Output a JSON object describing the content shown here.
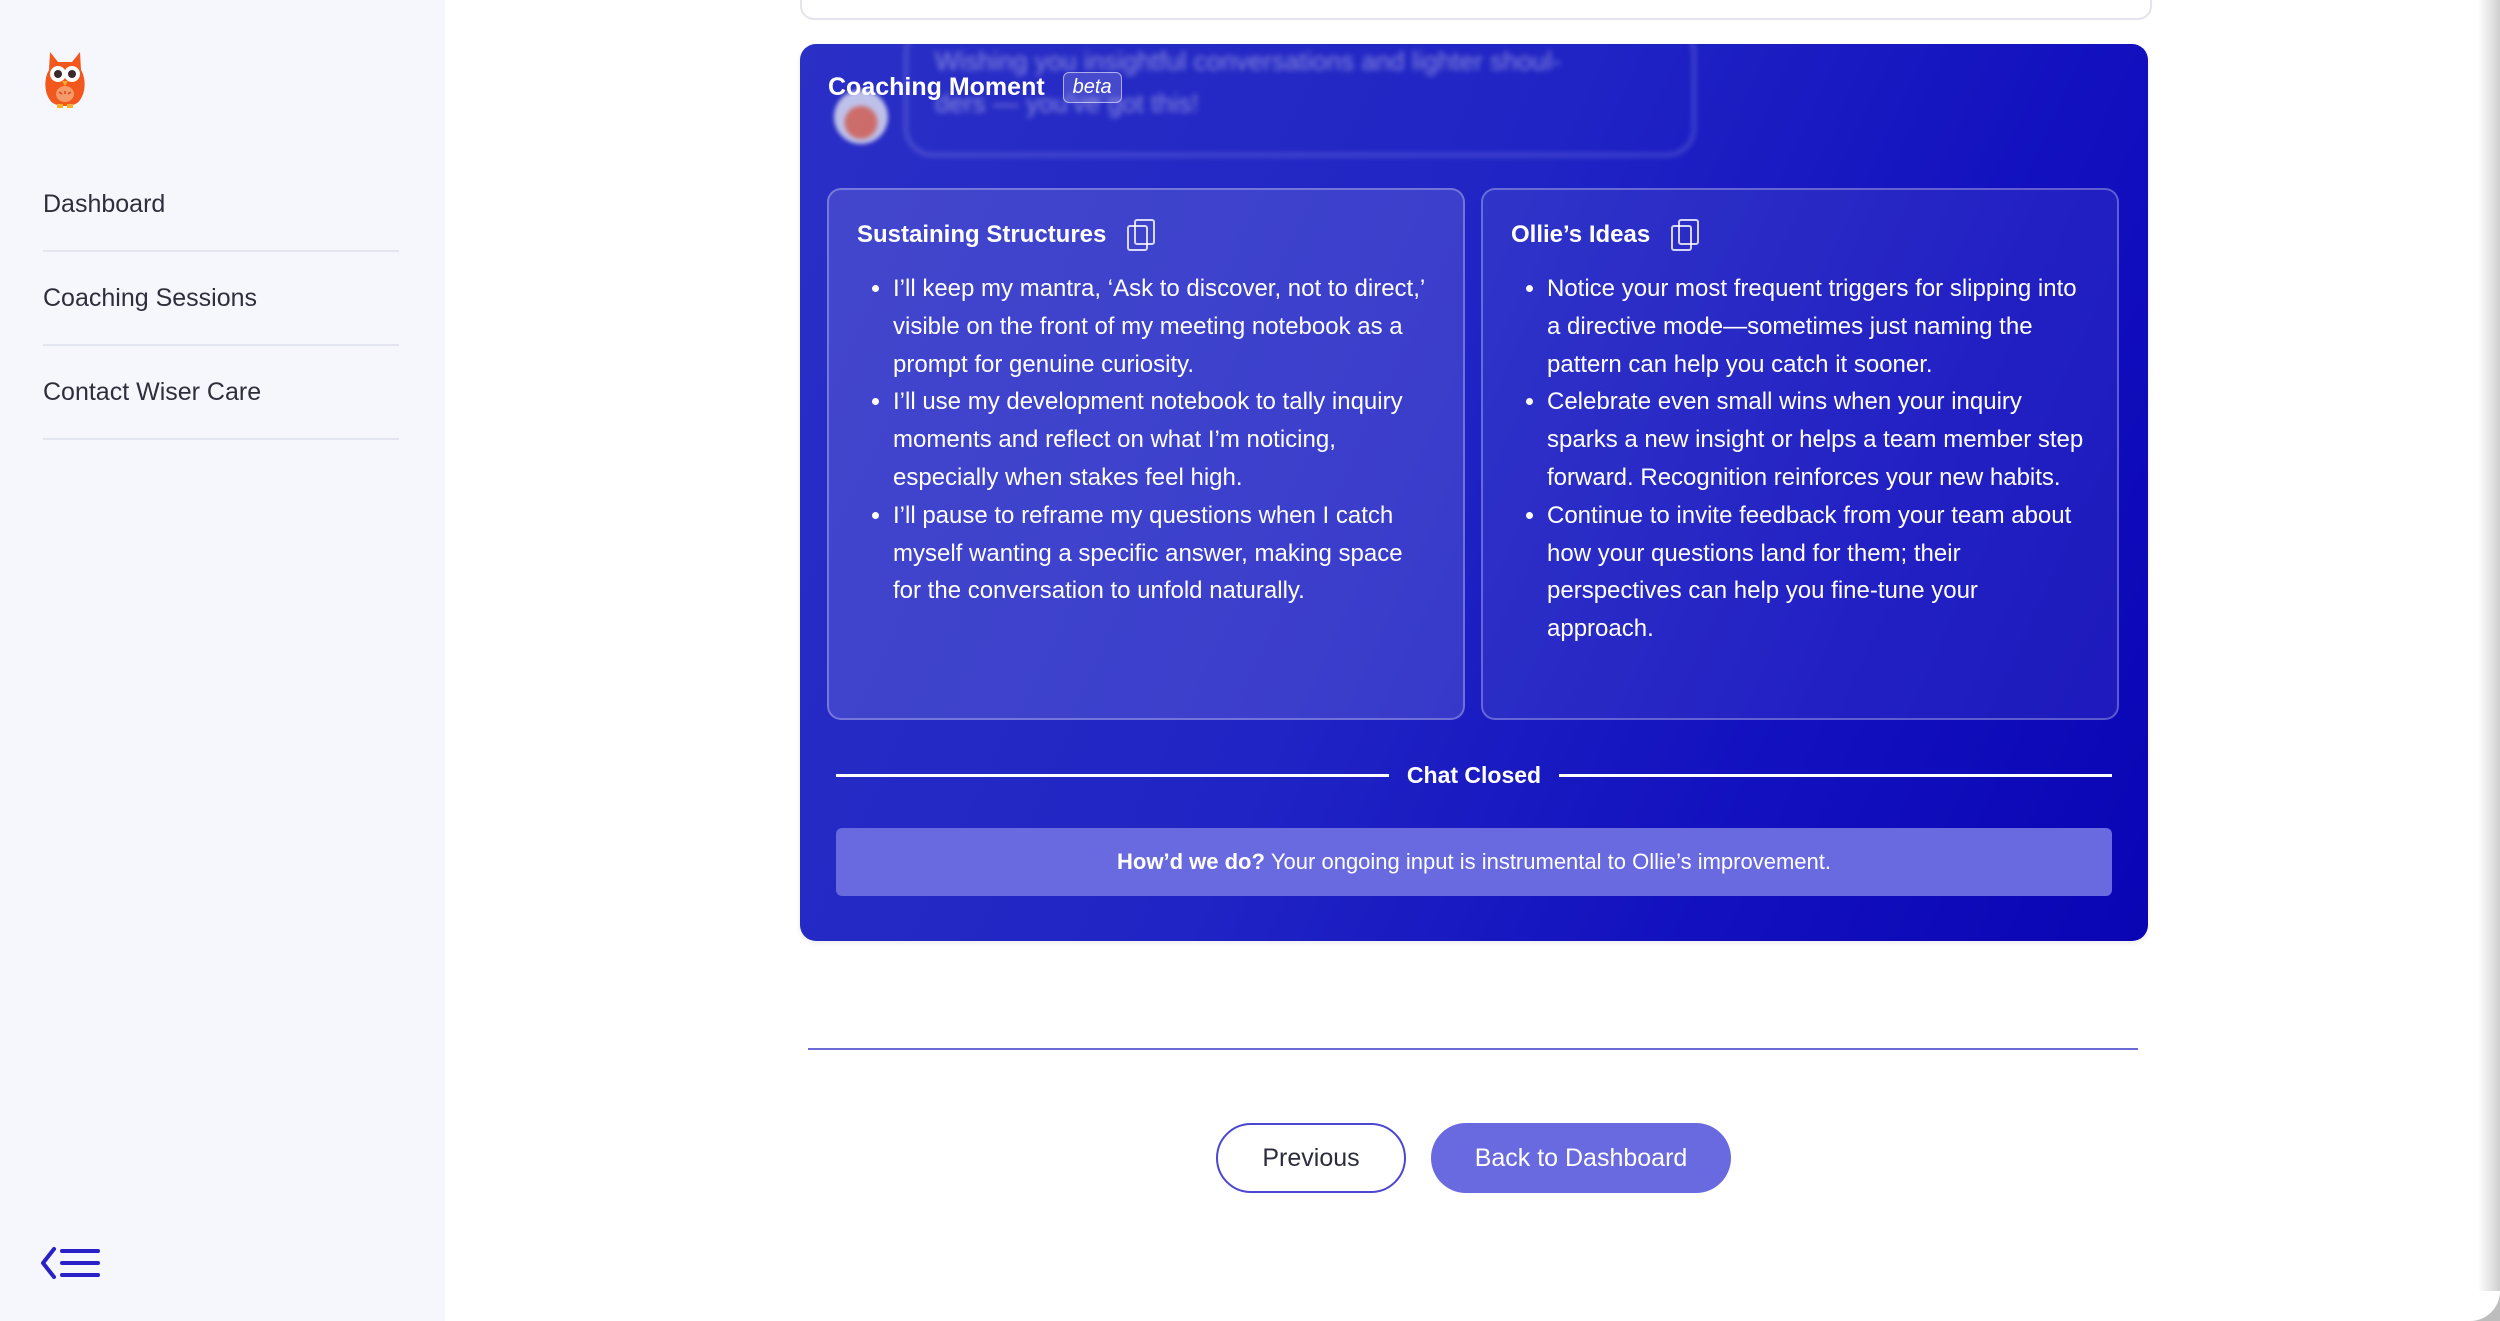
{
  "sidebar": {
    "items": [
      {
        "label": "Dashboard"
      },
      {
        "label": "Coaching Sessions"
      },
      {
        "label": "Contact Wiser Care"
      }
    ]
  },
  "background_chat": {
    "line1": "Wishing you insightful conversations and lighter shoul-",
    "line2": "ders — you've got this!"
  },
  "coaching_moment": {
    "title": "Coaching Moment",
    "badge": "beta",
    "sustaining": {
      "title": "Sustaining Structures",
      "items": [
        "I’ll keep my mantra, ‘Ask to discover, not to direct,’ visible on the front of my meeting notebook as a prompt for genuine curiosity.",
        "I’ll use my development notebook to tally inquiry moments and reflect on what I’m noticing, especially when stakes feel high.",
        "I’ll pause to reframe my questions when I catch myself wanting a specific answer, making space for the conversation to unfold naturally."
      ]
    },
    "ideas": {
      "title": "Ollie’s Ideas",
      "items": [
        "Notice your most frequent triggers for slipping into a directive mode—sometimes just naming the pattern can help you catch it sooner.",
        "Celebrate even small wins when your inquiry sparks a new insight or helps a team member step forward. Recognition reinforces your new habits.",
        "Continue to invite feedback from your team about how your questions land for them; their perspectives can help you fine-tune your approach."
      ]
    },
    "chat_closed": "Chat Closed",
    "feedback": {
      "bold": "How’d we do?",
      "text": "Your ongoing input is instrumental to Ollie’s improvement."
    }
  },
  "buttons": {
    "previous": "Previous",
    "back": "Back to Dashboard"
  },
  "colors": {
    "primary": "#6a6ae0",
    "panel_blue": "#1f22c2",
    "logo_orange": "#f2581e"
  },
  "icons": {
    "logo": "owl-logo-icon",
    "copy": "copy-icon",
    "collapse": "collapse-menu-icon"
  }
}
